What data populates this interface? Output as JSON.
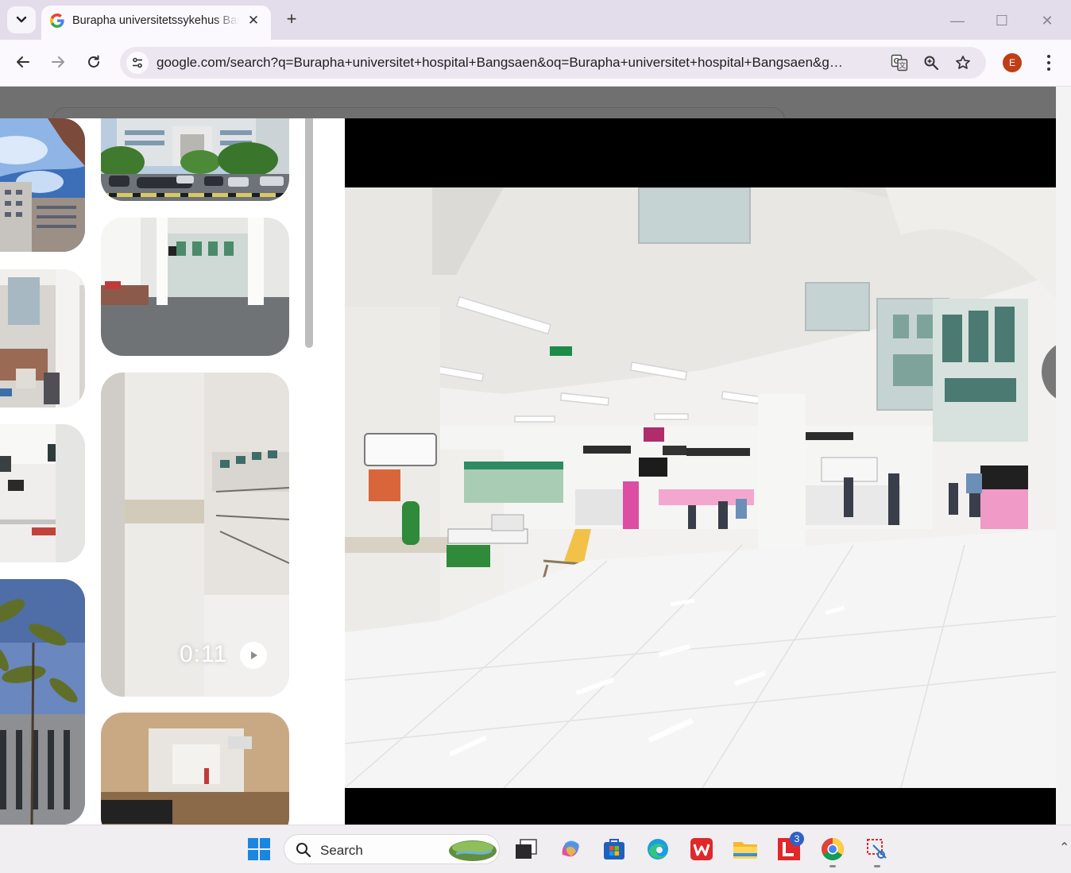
{
  "browser": {
    "tab": {
      "title": "Burapha universitetssykehus Bangsaen - Google Søk",
      "close_glyph": "✕"
    },
    "new_tab_glyph": "+",
    "window_controls": {
      "minimize": "—",
      "maximize": "☐",
      "close": "✕"
    },
    "url": "google.com/search?q=Burapha+universitet+hospital+Bangsaen&oq=Burapha+universitet+hospital+Bangsaen&gs_...",
    "profile_initial": "E",
    "icons": [
      "tab-search-icon",
      "google-favicon-icon",
      "back-arrow-icon",
      "forward-arrow-icon",
      "reload-icon",
      "site-info-icon",
      "translate-icon",
      "zoom-icon",
      "bookmark-star-icon",
      "kebab-menu-icon"
    ]
  },
  "viewer": {
    "video_thumb": {
      "duration": "0:11"
    }
  },
  "taskbar": {
    "search_label": "Search",
    "badge_count": "3",
    "apps": [
      "windows-start-icon",
      "search-icon",
      "task-view-icon",
      "copilot-icon",
      "microsoft-store-icon",
      "edge-icon",
      "wps-office-icon",
      "file-explorer-icon",
      "l-app-icon",
      "chrome-icon",
      "snipping-tool-icon"
    ]
  },
  "colors": {
    "tab_strip": "#e3dcea",
    "toolbar": "#fbf9fd",
    "omnibox": "#ece6f1",
    "avatar": "#c13d16",
    "overlay": "#6d6d6d",
    "taskbar": "#f0eef1"
  }
}
